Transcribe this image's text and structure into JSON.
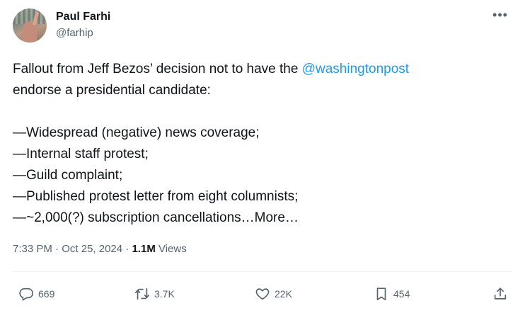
{
  "author": {
    "name": "Paul Farhi",
    "handle": "@farhip"
  },
  "tweet": {
    "line1_before": "Fallout from Jeff Bezos’ decision not to have the ",
    "mention": "@washingtonpost",
    "line2": "endorse a presidential candidate:",
    "items": [
      "—Widespread (negative) news coverage;",
      "—Internal staff protest;",
      "—Guild complaint;",
      "—Published protest letter from eight columnists;"
    ],
    "last_item": "—~2,000(?) subscription cancellations…",
    "more_label": "More…"
  },
  "meta": {
    "time": "7:33 PM",
    "sep1": " · ",
    "date": "Oct 25, 2024",
    "sep2": " · ",
    "views_count": "1.1M",
    "views_label": " Views"
  },
  "actions": {
    "replies": "669",
    "reposts": "3.7K",
    "likes": "22K",
    "bookmarks": "454"
  },
  "colors": {
    "accent": "#1d9bf0",
    "secondary_text": "#536471",
    "primary_text": "#0f1419"
  },
  "icons": {
    "more": "more-horizontal-icon",
    "reply": "reply-icon",
    "repost": "repost-icon",
    "like": "heart-icon",
    "bookmark": "bookmark-icon",
    "share": "share-icon"
  }
}
